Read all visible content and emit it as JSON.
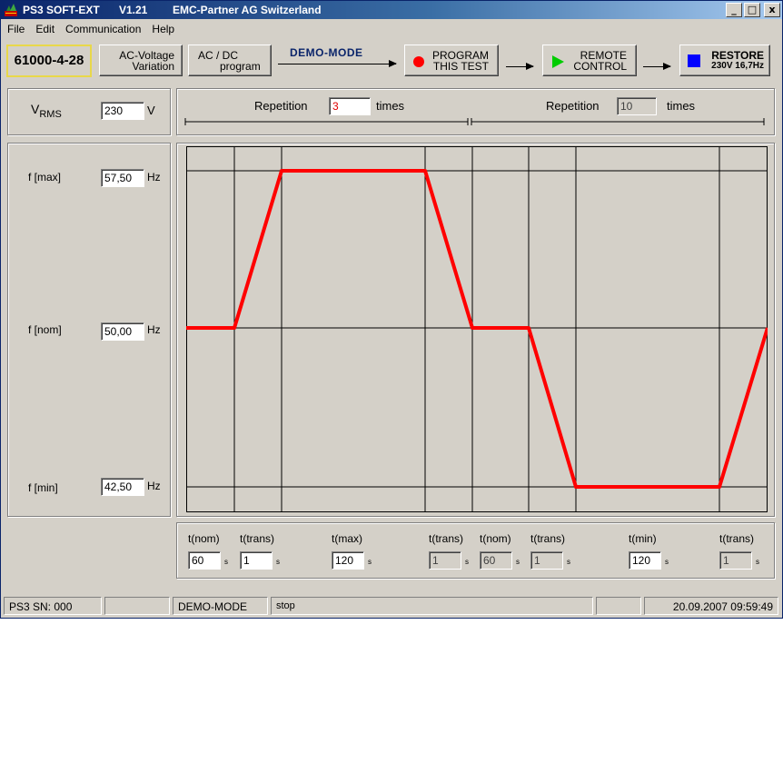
{
  "window": {
    "app_name": "PS3 SOFT-EXT",
    "version": "V1.21",
    "company": "EMC-Partner AG Switzerland",
    "btn_min": "_",
    "btn_max": "□",
    "btn_close": "x"
  },
  "menu": [
    "File",
    "Edit",
    "Communication",
    "Help"
  ],
  "toolbar": {
    "standard": "61000-4-28",
    "ac_voltage_l1": "AC-Voltage",
    "ac_voltage_l2": "Variation",
    "acdc_l1": "AC / DC",
    "acdc_l2": "program",
    "mode": "DEMO-MODE",
    "program_l1": "PROGRAM",
    "program_l2": "THIS TEST",
    "remote_l1": "REMOTE",
    "remote_l2": "CONTROL",
    "restore_l1": "RESTORE",
    "restore_l2": "230V 16,7Hz",
    "colors": {
      "program": "#ff0000",
      "remote": "#00cc00",
      "restore": "#0000ff"
    }
  },
  "vrms": {
    "label": "V",
    "sub": "RMS",
    "value": "230",
    "unit": "V"
  },
  "repetition": {
    "left_label": "Repetition",
    "left_value": "3",
    "left_unit": "times",
    "right_label": "Repetition",
    "right_value": "10",
    "right_unit": "times"
  },
  "freq": {
    "max_label": "f [max]",
    "max_value": "57,50",
    "max_unit": "Hz",
    "nom_label": "f [nom]",
    "nom_value": "50,00",
    "nom_unit": "Hz",
    "min_label": "f [min]",
    "min_value": "42,50",
    "min_unit": "Hz"
  },
  "times": [
    {
      "label": "t(nom)",
      "value": "60",
      "unit": "s",
      "readonly": false
    },
    {
      "label": "t(trans)",
      "value": "1",
      "unit": "s",
      "readonly": false
    },
    {
      "label": "t(max)",
      "value": "120",
      "unit": "s",
      "readonly": false
    },
    {
      "label": "t(trans)",
      "value": "1",
      "unit": "s",
      "readonly": true
    },
    {
      "label": "t(nom)",
      "value": "60",
      "unit": "s",
      "readonly": true
    },
    {
      "label": "t(trans)",
      "value": "1",
      "unit": "s",
      "readonly": true
    },
    {
      "label": "t(min)",
      "value": "120",
      "unit": "s",
      "readonly": false
    },
    {
      "label": "t(trans)",
      "value": "1",
      "unit": "s",
      "readonly": true
    }
  ],
  "profile": {
    "color": "#ff0000",
    "levels": [
      "nom",
      "nom",
      "max",
      "max",
      "nom",
      "nom",
      "min",
      "min",
      "nom"
    ]
  },
  "status": {
    "device": "PS3  SN: 000",
    "mode": "DEMO-MODE",
    "state": "stop",
    "datetime": "20.09.2007  09:59:49"
  }
}
